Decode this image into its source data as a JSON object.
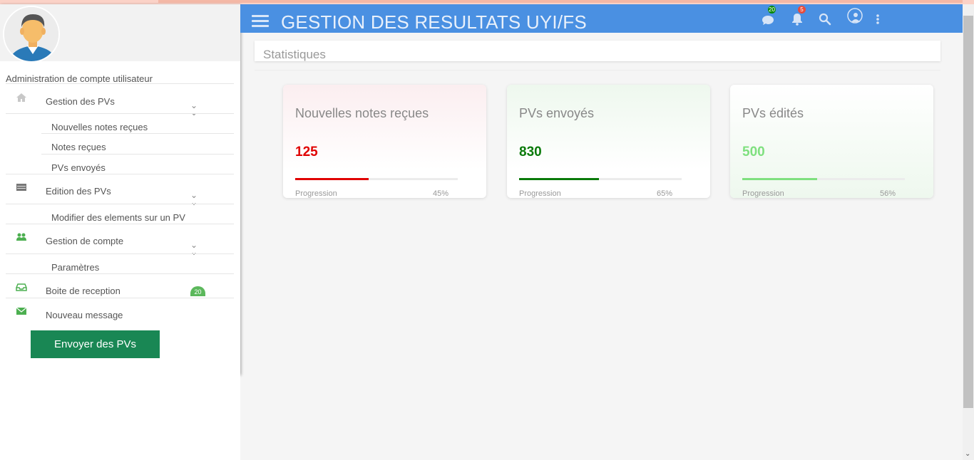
{
  "header": {
    "title": "GESTION DES RESULTATS UYI/FS",
    "messages_badge": "20",
    "notifications_badge": "5",
    "color": "#4a90e2"
  },
  "sidebar": {
    "admin_title": "Administration de compte utilisateur",
    "menu": [
      {
        "label": "Gestion des PVs",
        "icon": "home-icon",
        "subitems": [
          "Nouvelles notes reçues",
          "Notes reçues",
          "PVs envoyés"
        ]
      },
      {
        "label": "Edition des PVs",
        "icon": "table-icon",
        "subitems": [
          "Modifier des elements sur un PV"
        ]
      },
      {
        "label": "Gestion de compte",
        "icon": "users-icon",
        "subitems": [
          "Paramètres"
        ]
      },
      {
        "label": "Boite de reception",
        "icon": "inbox-icon",
        "badge": "20"
      },
      {
        "label": "Nouveau message",
        "icon": "envelope-icon"
      }
    ],
    "send_button": "Envoyer des PVs"
  },
  "main": {
    "section_title": "Statistiques",
    "cards": [
      {
        "title": "Nouvelles notes reçues",
        "value": "125",
        "progress_label": "Progression",
        "progress_text": "45%",
        "progress": 0.45,
        "color": "#e00000"
      },
      {
        "title": "PVs envoyés",
        "value": "830",
        "progress_label": "Progression",
        "progress_text": "65%",
        "progress": 0.49,
        "color": "#0a7a0a"
      },
      {
        "title": "PVs édités",
        "value": "500",
        "progress_label": "Progression",
        "progress_text": "56%",
        "progress": 0.46,
        "color": "#7fe07f"
      }
    ]
  }
}
